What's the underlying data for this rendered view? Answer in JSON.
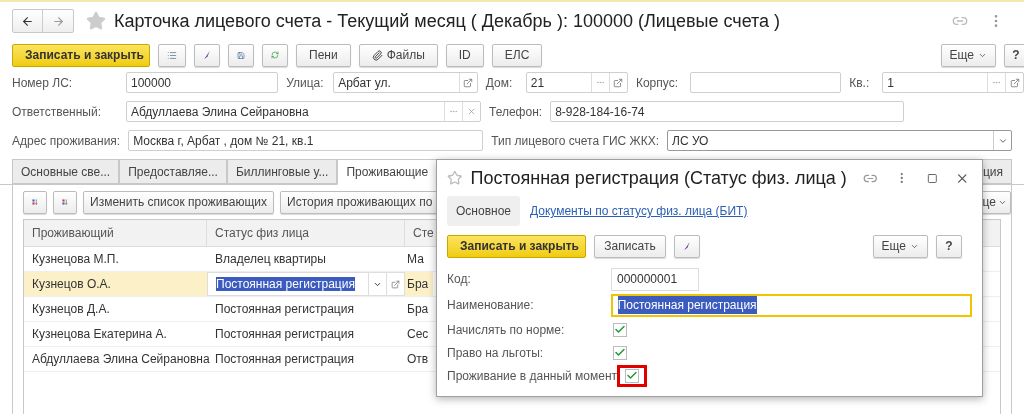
{
  "window": {
    "title": "Карточка лицевого счета - Текущий месяц ( Декабрь ): 100000 (Лицевые счета )",
    "favorite": false
  },
  "toolbar": {
    "save_close": "Записать и закрыть",
    "text_buttons": [
      "Пени",
      "Файлы",
      "ID",
      "ЕЛС"
    ],
    "more": "Еще",
    "help": "?"
  },
  "form_rows": [
    [
      {
        "label": "Номер ЛС:",
        "value": "100000",
        "kind": "text"
      },
      {
        "label": "Улица:",
        "value": "Арбат ул.",
        "kind": "open"
      },
      {
        "label": "Дом:",
        "value": "21",
        "kind": "ref"
      },
      {
        "label": "Корпус:",
        "kind": "text"
      },
      {
        "label": "Кв.:",
        "value": "1",
        "kind": "ref"
      }
    ],
    [
      {
        "label": "Ответственный:",
        "value": "Абдуллаева Элина Сейрановна",
        "kind": "clear"
      },
      {
        "label": "Телефон:",
        "value": "8-928-184-16-74",
        "kind": "text"
      }
    ],
    [
      {
        "label": "Адрес проживания:",
        "value": "Москва г, Арбат , дом № 21, кв.1",
        "kind": "text"
      },
      {
        "label": "Тип лицевого счета ГИС ЖКХ:",
        "value": "ЛС УО",
        "kind": "dropdown"
      }
    ]
  ],
  "tabs": [
    {
      "label": "Основные све...",
      "selected": false
    },
    {
      "label": "Предоставляе...",
      "selected": false
    },
    {
      "label": "Биллинговые у...",
      "selected": false
    },
    {
      "label": "Проживающие",
      "selected": true
    },
    {
      "label": "ция",
      "selected": false
    }
  ],
  "residents_toolbar": {
    "buttons": [
      "Изменить список проживающих",
      "История проживающих по"
    ],
    "more": "це"
  },
  "table": {
    "columns": [
      "Проживающий",
      "Статус физ лица",
      "Сте"
    ],
    "rows": [
      {
        "cells": [
          "Кузнецова М.П.",
          "Владелец квартиры",
          "Ма"
        ],
        "selected": false
      },
      {
        "cells": [
          "Кузнецов О.А.",
          "Постоянная регистрация",
          "Бра"
        ],
        "selected": true
      },
      {
        "cells": [
          "Кузнецов Д.А.",
          "Постоянная регистрация",
          "Бра"
        ],
        "selected": false
      },
      {
        "cells": [
          "Кузнецова Екатерина А.",
          "Постоянная регистрация",
          "Сес"
        ],
        "selected": false
      },
      {
        "cells": [
          "Абдуллаева Элина Сейрановна",
          "Постоянная регистрация",
          "Отв"
        ],
        "selected": false
      }
    ]
  },
  "dialog": {
    "title": "Постоянная регистрация (Статус физ. лица )",
    "favorite": false,
    "tabs": [
      {
        "label": "Основное",
        "selected": true
      },
      {
        "label": "Документы по статусу физ. лица (БИТ)",
        "selected": false
      }
    ],
    "buttons": {
      "save_close": "Записать и закрыть",
      "save": "Записать",
      "more": "Еще",
      "help": "?"
    },
    "fields": [
      {
        "label": "Код:",
        "value": "000000001",
        "focused": false
      },
      {
        "label": "Наименование:",
        "value": "Постоянная регистрация",
        "focused": true
      }
    ],
    "checkboxes": [
      {
        "label": "Начислять по норме:",
        "checked": true,
        "highlighted": false
      },
      {
        "label": "Право на льготы:",
        "checked": true,
        "highlighted": false
      },
      {
        "label": "Проживание в данный момент",
        "checked": true,
        "highlighted": true
      }
    ]
  }
}
